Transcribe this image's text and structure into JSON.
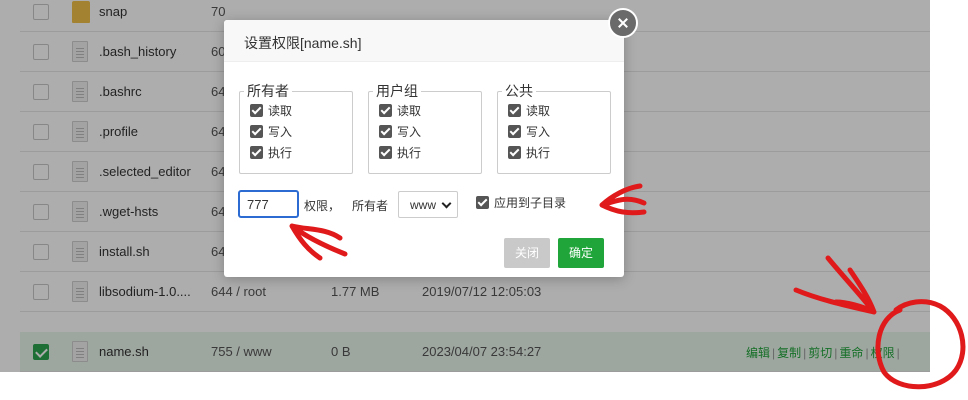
{
  "file_list": {
    "rows": [
      {
        "name": "snap",
        "perm": "70",
        "size": "",
        "date": "",
        "type": "folder",
        "selected": false
      },
      {
        "name": ".bash_history",
        "perm": "60",
        "size": "",
        "date": "",
        "type": "file",
        "selected": false
      },
      {
        "name": ".bashrc",
        "perm": "64",
        "size": "",
        "date": "",
        "type": "file",
        "selected": false
      },
      {
        "name": ".profile",
        "perm": "64",
        "size": "",
        "date": "",
        "type": "file",
        "selected": false
      },
      {
        "name": ".selected_editor",
        "perm": "64",
        "size": "",
        "date": "",
        "type": "file",
        "selected": false
      },
      {
        "name": ".wget-hsts",
        "perm": "64",
        "size": "",
        "date": "",
        "type": "file",
        "selected": false
      },
      {
        "name": "install.sh",
        "perm": "64",
        "size": "",
        "date": "",
        "type": "file",
        "selected": false
      },
      {
        "name": "libsodium-1.0....",
        "perm": "644 / root",
        "size": "1.77 MB",
        "date": "2019/07/12 12:05:03",
        "type": "file",
        "selected": false
      },
      {
        "name": "name.sh",
        "perm": "755 / www",
        "size": "0 B",
        "date": "2023/04/07 23:54:27",
        "type": "file",
        "selected": true
      }
    ],
    "actions": {
      "edit": "编辑",
      "copy": "复制",
      "cut": "剪切",
      "rename": "重命",
      "perm": "权限",
      "sep": "|"
    }
  },
  "dialog": {
    "title": "设置权限[name.sh]",
    "groups": {
      "owner": {
        "legend": "所有者",
        "read": "读取",
        "write": "写入",
        "exec": "执行"
      },
      "group": {
        "legend": "用户组",
        "read": "读取",
        "write": "写入",
        "exec": "执行"
      },
      "public": {
        "legend": "公共",
        "read": "读取",
        "write": "写入",
        "exec": "执行"
      }
    },
    "perm_value": "777",
    "perm_label": "权限，",
    "owner_label": "所有者",
    "owner_value": "www",
    "apply_sub_label": "应用到子目录",
    "close_button": "关闭",
    "ok_button": "确定"
  },
  "colors": {
    "accent": "#20a53a",
    "annotation": "#e0191b"
  },
  "icons": {
    "close": "close-icon",
    "file": "file-icon",
    "folder": "folder-icon",
    "dropdown": "chevron-down-icon"
  }
}
